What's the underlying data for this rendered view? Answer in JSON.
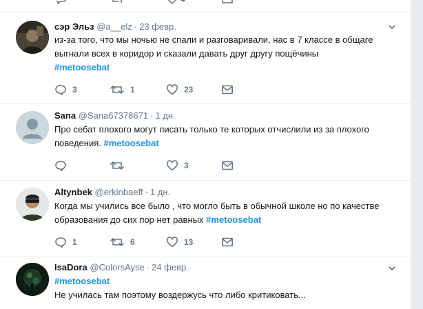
{
  "colors": {
    "hashtag": "#1b95e0",
    "meta": "#657786",
    "text": "#14171a",
    "border": "#e6ecf0"
  },
  "top_stub": {
    "like_count": "4"
  },
  "tweets": [
    {
      "name": "сэр Эльз",
      "handle": "@a__elz",
      "date": "23 февр.",
      "text": "из-за того, что мы ночью не спали и разговаривали, нас в 7 классе в общаге выгнали всех в коридор и сказали давать друг другу пощёчины",
      "hashtag": "#metoosebat",
      "avatar_icon": "user-photo",
      "reply_count": "3",
      "retweet_count": "1",
      "like_count": "23"
    },
    {
      "name": "Sana",
      "handle": "@Sana67378671",
      "date": "1 дн.",
      "text": "Про себат плохого могут писать только те которых отчислили из за плохого поведения.",
      "hashtag": "#metoosebat",
      "avatar_icon": "default-avatar-icon",
      "reply_count": "",
      "retweet_count": "",
      "like_count": "3"
    },
    {
      "name": "Altynbek",
      "handle": "@erkinbaeff",
      "date": "1 дн.",
      "text": "Когда мы учились все было , что могло быть в обычной школе но по качестве образования до сих пор нет равных",
      "hashtag": "#metoosebat",
      "avatar_icon": "user-photo",
      "reply_count": "1",
      "retweet_count": "6",
      "like_count": "13"
    },
    {
      "name": "IsaDora",
      "handle": "@ColorsAyse",
      "date": "24 февр.",
      "hashtag": "#metoosebat",
      "text": "Не училась там поэтому воздержусь что либо критиковать...",
      "avatar_icon": "user-photo"
    }
  ]
}
